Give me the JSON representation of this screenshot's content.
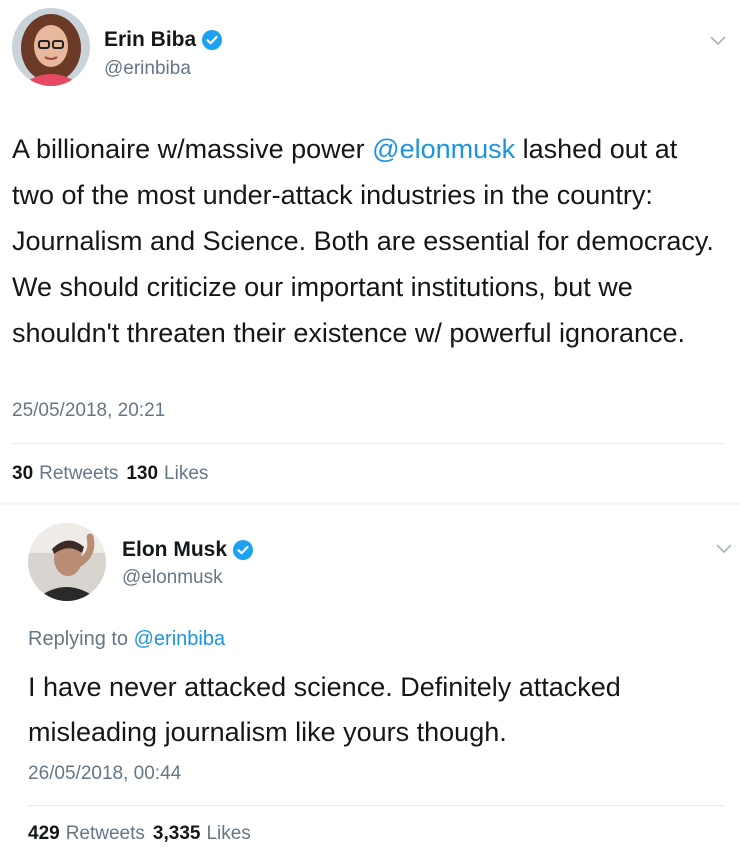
{
  "tweets": [
    {
      "display_name": "Erin Biba",
      "handle": "@erinbiba",
      "text_before": "A billionaire w/massive power ",
      "mention": "@elonmusk",
      "text_after": " lashed out at two of the most under-attack industries in the country: Journalism and Science. Both are essential for democracy. We should criticize our important institutions, but we shouldn't threaten their existence w/ powerful ignorance.",
      "timestamp": "25/05/2018, 20:21",
      "retweets": "30",
      "retweets_label": "Retweets",
      "likes": "130",
      "likes_label": "Likes"
    },
    {
      "display_name": "Elon Musk",
      "handle": "@elonmusk",
      "replying_to_label": "Replying to",
      "replying_to": "@erinbiba",
      "text": "I have never attacked science. Definitely attacked misleading journalism like yours though.",
      "timestamp": "26/05/2018, 00:44",
      "retweets": "429",
      "retweets_label": "Retweets",
      "likes": "3,335",
      "likes_label": "Likes"
    }
  ],
  "icons": {
    "verified": "verified-badge-icon",
    "menu": "chevron-down-icon"
  },
  "colors": {
    "link": "#1b95e0",
    "secondary_text": "#657786",
    "verified": "#1da1f2"
  }
}
